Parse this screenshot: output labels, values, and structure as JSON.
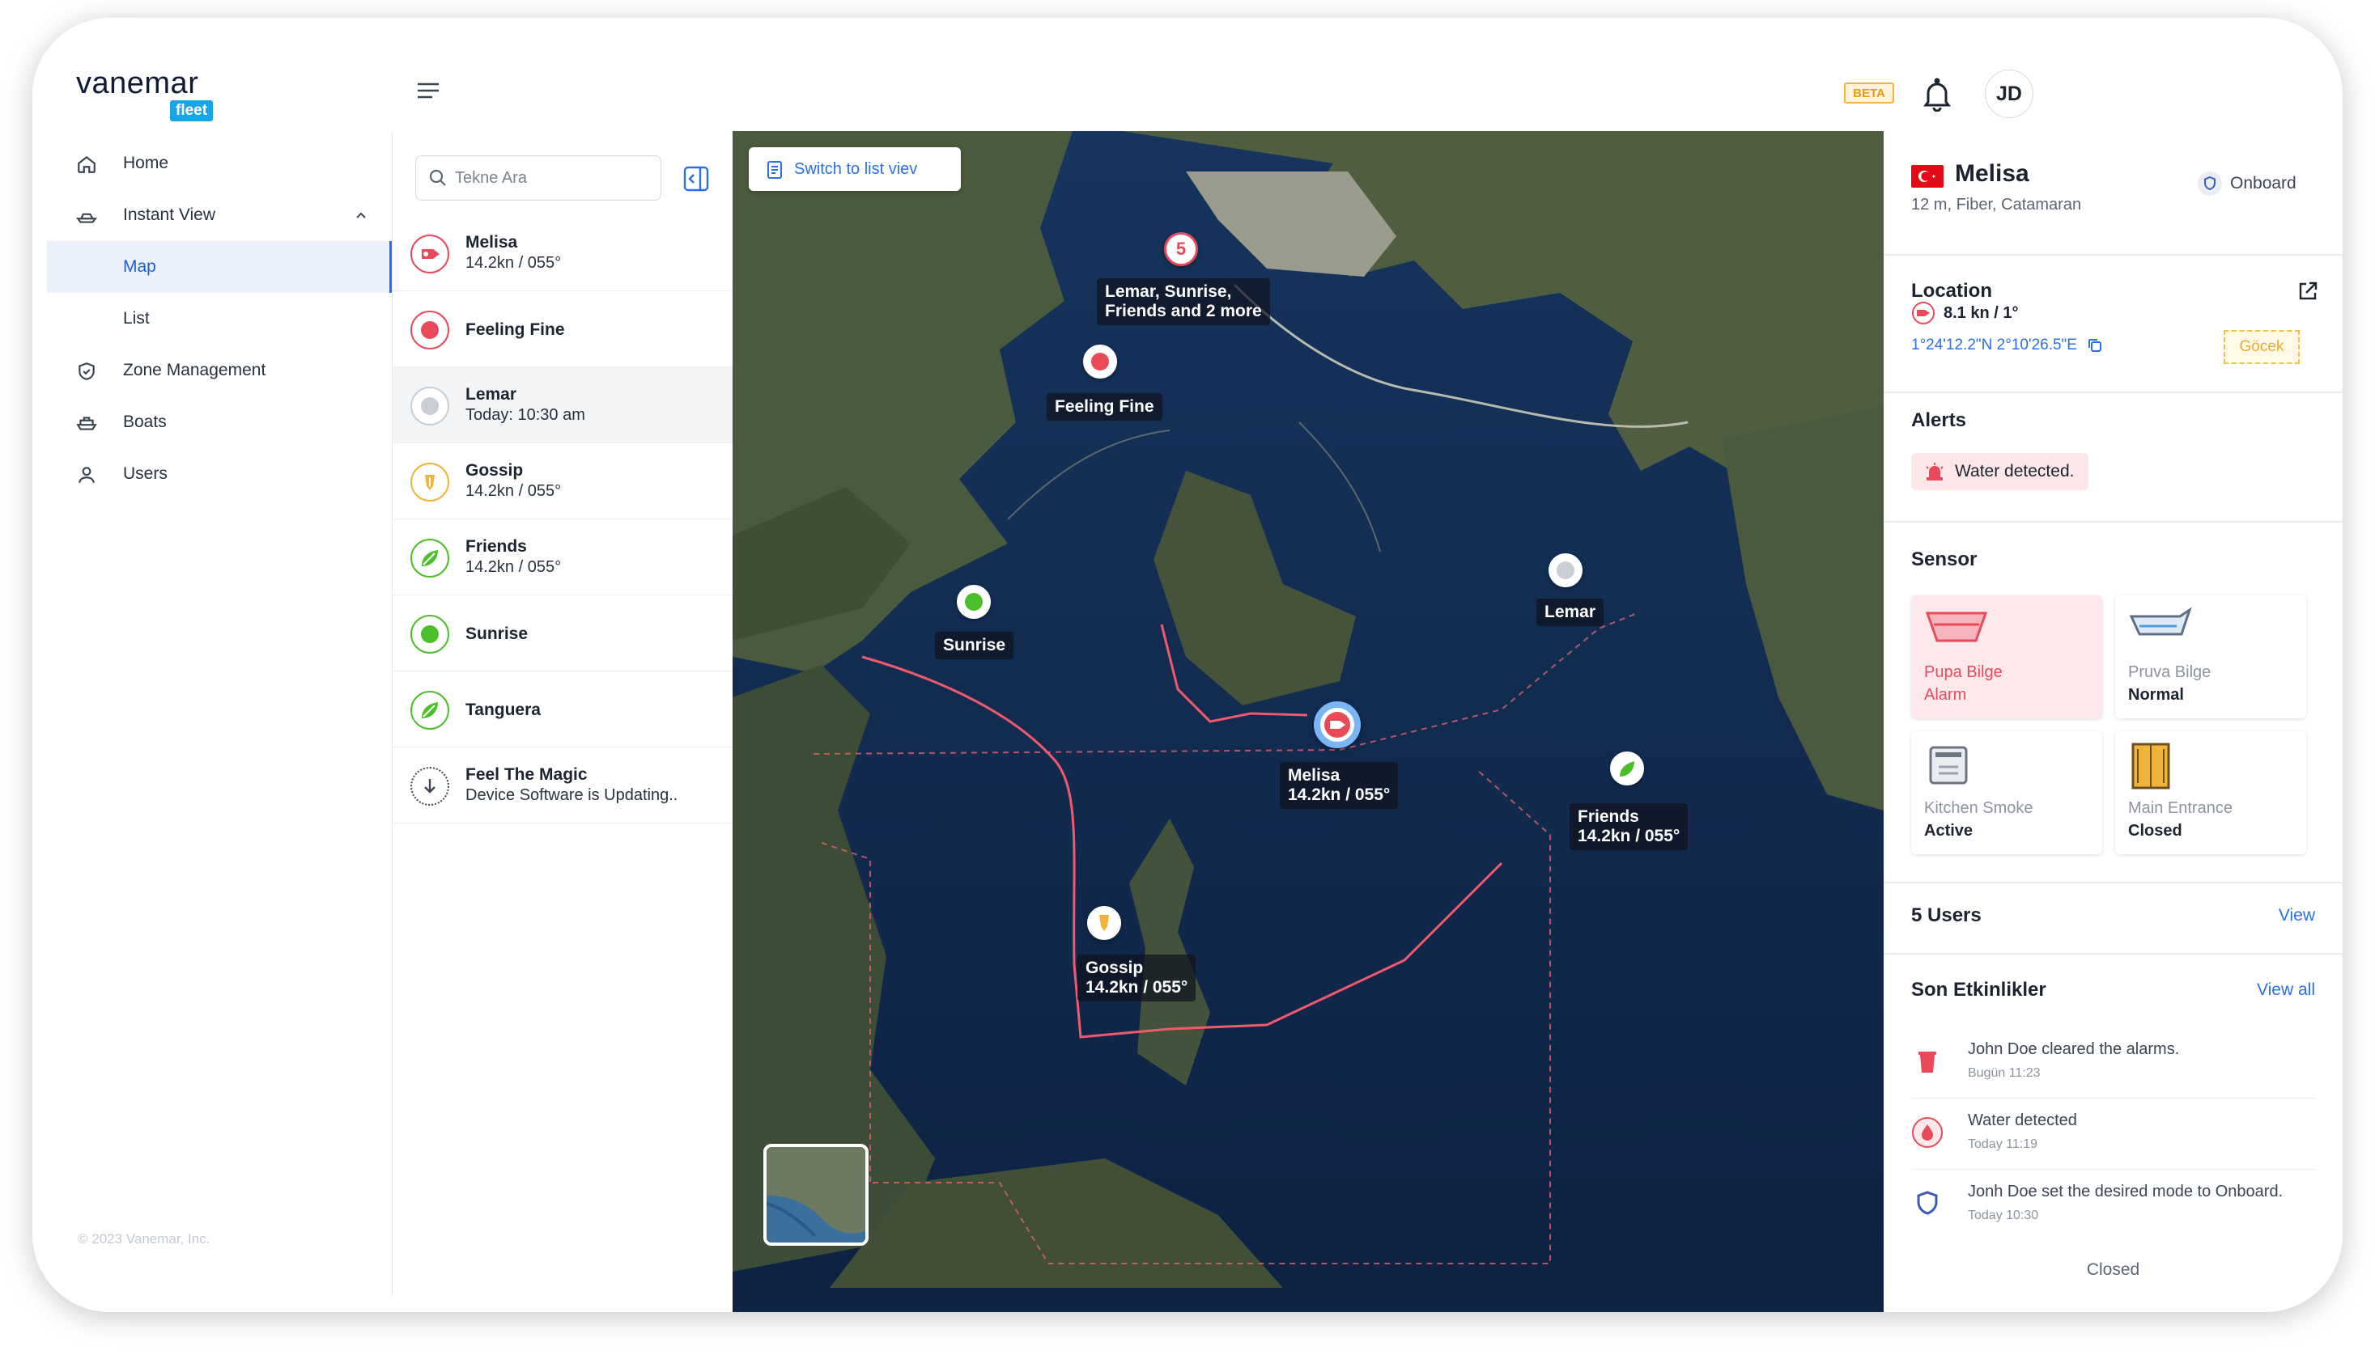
{
  "brand": {
    "word": "vanemar",
    "badge": "fleet"
  },
  "nav": {
    "home": "Home",
    "instant_view": "Instant View",
    "map": "Map",
    "list": "List",
    "zone_management": "Zone Management",
    "boats": "Boats",
    "users": "Users"
  },
  "copyright": "© 2023 Vanemar, Inc.",
  "header": {
    "beta": "BETA",
    "avatar": "JD"
  },
  "search": {
    "placeholder": "Tekne Ara"
  },
  "vessels": [
    {
      "name": "Melisa",
      "sub": "14.2kn / 055°",
      "icon": "boat-motor-icon",
      "color": "#e84a5a"
    },
    {
      "name": "Feeling Fine",
      "sub": "",
      "icon": "status-dot-icon",
      "color": "#e84a5a"
    },
    {
      "name": "Lemar",
      "sub": "Today: 10:30 am",
      "icon": "status-dot-icon",
      "color": "#c9ced6"
    },
    {
      "name": "Gossip",
      "sub": "14.2kn / 055°",
      "icon": "anchor-drop-icon",
      "color": "#f2b33a"
    },
    {
      "name": "Friends",
      "sub": "14.2kn / 055°",
      "icon": "sail-icon",
      "color": "#4bbf2a"
    },
    {
      "name": "Sunrise",
      "sub": "",
      "icon": "status-dot-icon",
      "color": "#4bbf2a"
    },
    {
      "name": "Tanguera",
      "sub": "",
      "icon": "sail-icon",
      "color": "#4bbf2a"
    },
    {
      "name": "Feel The Magic",
      "sub": "Device Software is Updating..",
      "icon": "updating-icon",
      "color": "#3b4452"
    }
  ],
  "map": {
    "switch_label": "Switch to list viev",
    "cluster_count": "5",
    "cluster_label_1": "Lemar, Sunrise,",
    "cluster_label_2": "Friends and 2 more",
    "labels": {
      "feeling_fine": "Feeling Fine",
      "sunrise": "Sunrise",
      "lemar": "Lemar",
      "melisa_1": "Melisa",
      "melisa_2": "14.2kn / 055°",
      "friends_1": "Friends",
      "friends_2": "14.2kn / 055°",
      "gossip_1": "Gossip",
      "gossip_2": "14.2kn / 055°"
    }
  },
  "detail": {
    "name": "Melisa",
    "specs": "12 m, Fiber, Catamaran",
    "mode": "Onboard",
    "location_title": "Location",
    "speed": "8.1 kn / 1°",
    "coords": "1°24'12.2\"N 2°10'26.5\"E",
    "place": "Göcek",
    "alerts_title": "Alerts",
    "alert_text": "Water detected.",
    "sensor_title": "Sensor",
    "sensors": [
      {
        "name": "Pupa Bilge",
        "state": "Alarm"
      },
      {
        "name": "Pruva Bilge",
        "state": "Normal"
      },
      {
        "name": "Kitchen Smoke",
        "state": "Active"
      },
      {
        "name": "Main Entrance",
        "state": "Closed"
      }
    ],
    "users_title": "5 Users",
    "users_link": "View",
    "activity_title": "Son Etkinlikler",
    "activity_link": "View all",
    "activities": [
      {
        "text": "John Doe cleared the alarms.",
        "time": "Bugün 11:23"
      },
      {
        "text": "Water detected",
        "time": "Today 11:19"
      },
      {
        "text": "Jonh Doe set the desired mode to Onboard.",
        "time": "Today 10:30"
      }
    ],
    "closed_label": "Closed"
  },
  "colors": {
    "accent": "#2a6fe6",
    "alarm": "#e84a5a",
    "ok": "#4bbf2a",
    "warn": "#f2b33a"
  }
}
